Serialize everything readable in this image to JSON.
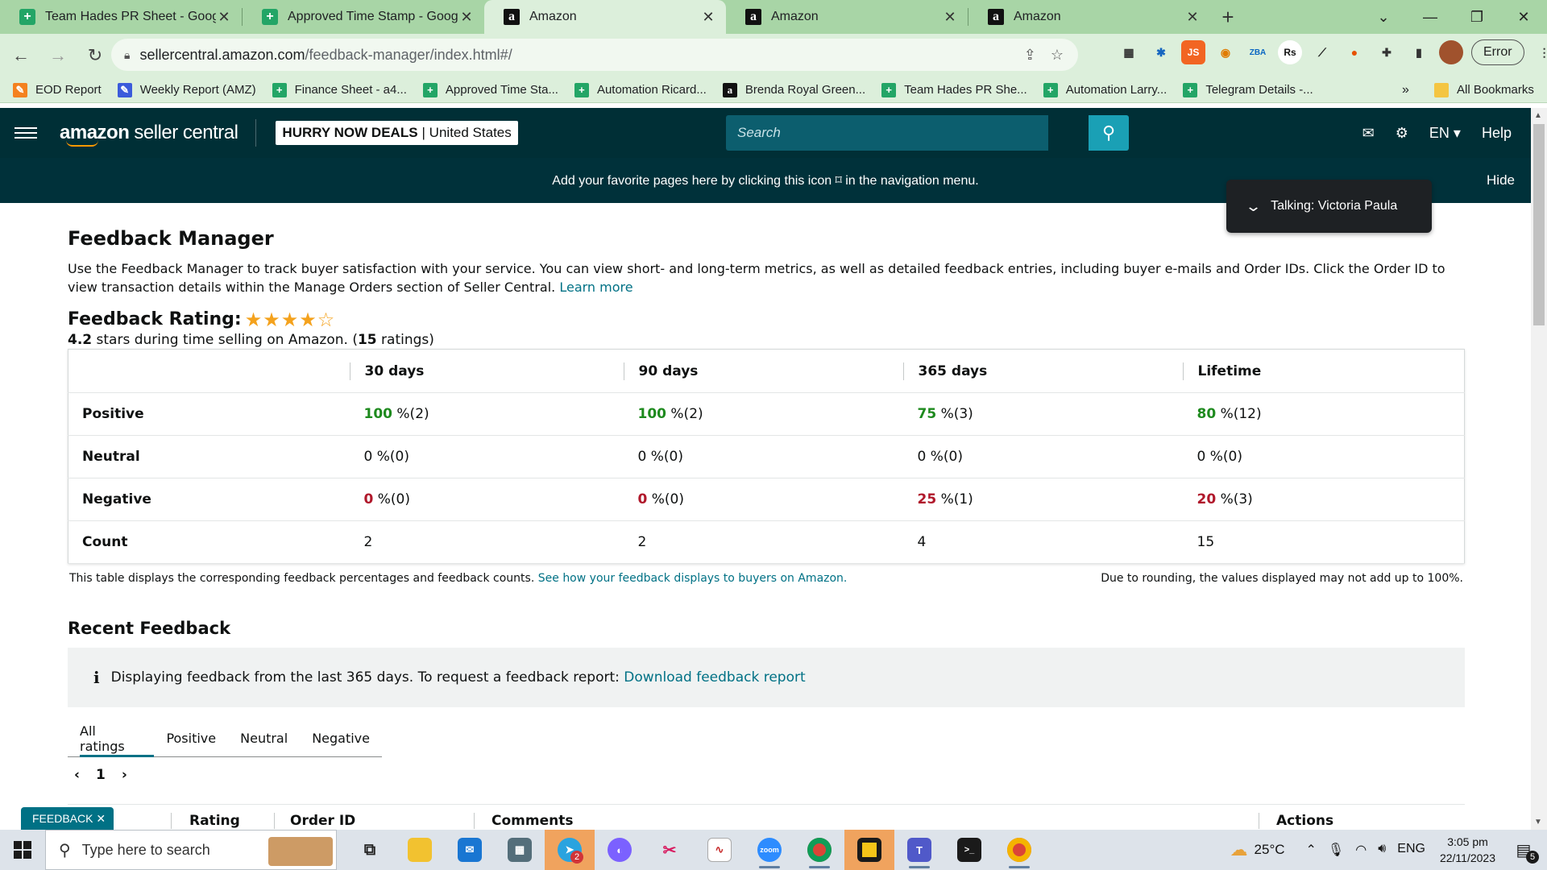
{
  "browser": {
    "tabs": [
      {
        "title": "Team Hades PR Sheet - Google S",
        "icon": "sheets",
        "active": false
      },
      {
        "title": "Approved Time Stamp - Google",
        "icon": "sheets",
        "active": false
      },
      {
        "title": "Amazon",
        "icon": "amazon",
        "active": true
      },
      {
        "title": "Amazon",
        "icon": "amazon",
        "active": false
      },
      {
        "title": "Amazon",
        "icon": "amazon",
        "active": false
      }
    ],
    "url_host": "sellercentral.amazon.com",
    "url_path": "/feedback-manager/index.html#/",
    "profile_status": "Error",
    "bookmarks": [
      {
        "label": "EOD Report",
        "icon": "orange"
      },
      {
        "label": "Weekly Report (AMZ)",
        "icon": "blue"
      },
      {
        "label": "Finance Sheet - a4...",
        "icon": "sheets"
      },
      {
        "label": "Approved Time Sta...",
        "icon": "sheets"
      },
      {
        "label": "Automation Ricard...",
        "icon": "sheets"
      },
      {
        "label": "Brenda Royal Green...",
        "icon": "amazon"
      },
      {
        "label": "Team Hades PR She...",
        "icon": "sheets"
      },
      {
        "label": "Automation Larry...",
        "icon": "sheets"
      },
      {
        "label": "Telegram Details -...",
        "icon": "sheets"
      }
    ],
    "bookmarks_more": "»",
    "all_bookmarks": "All Bookmarks"
  },
  "header": {
    "logo_bold": "amazon",
    "logo_rest": "seller central",
    "store_name": "HURRY NOW DEALS",
    "store_region": "| United States",
    "search_placeholder": "Search",
    "language": "EN",
    "help": "Help"
  },
  "banner": {
    "text": "Add your favorite pages here by clicking this icon ⌑ in the navigation menu.",
    "hide": "Hide"
  },
  "talking_popup": "Talking: Victoria Paula",
  "page": {
    "title": "Feedback Manager",
    "intro": "Use the Feedback Manager to track buyer satisfaction with your service. You can view short- and long-term metrics, as well as detailed feedback entries, including buyer e-mails and Order IDs. Click the Order ID to view transaction details within the Manage Orders section of Seller Central.",
    "learn_more": "Learn more",
    "rating_label": "Feedback Rating:",
    "rating_stars": 4,
    "rating_value": "4.2",
    "rating_mid": "stars during time selling on Amazon. (",
    "rating_count": "15",
    "rating_end": "ratings)",
    "table": {
      "headers": [
        "30 days",
        "90 days",
        "365 days",
        "Lifetime"
      ],
      "rows": [
        {
          "label": "Positive",
          "kind": "pos",
          "cells": [
            {
              "pct": "100",
              "cnt": "%(2)"
            },
            {
              "pct": "100",
              "cnt": "%(2)"
            },
            {
              "pct": "75",
              "cnt": "%(3)"
            },
            {
              "pct": "80",
              "cnt": "%(12)"
            }
          ]
        },
        {
          "label": "Neutral",
          "kind": "neu",
          "cells": [
            {
              "pct": "0",
              "cnt": "%(0)"
            },
            {
              "pct": "0",
              "cnt": "%(0)"
            },
            {
              "pct": "0",
              "cnt": "%(0)"
            },
            {
              "pct": "0",
              "cnt": "%(0)"
            }
          ]
        },
        {
          "label": "Negative",
          "kind": "neg",
          "cells": [
            {
              "pct": "0",
              "cnt": "%(0)"
            },
            {
              "pct": "0",
              "cnt": "%(0)"
            },
            {
              "pct": "25",
              "cnt": "%(1)"
            },
            {
              "pct": "20",
              "cnt": "%(3)"
            }
          ]
        },
        {
          "label": "Count",
          "kind": "count",
          "cells": [
            {
              "pct": "2",
              "cnt": ""
            },
            {
              "pct": "2",
              "cnt": ""
            },
            {
              "pct": "4",
              "cnt": ""
            },
            {
              "pct": "15",
              "cnt": ""
            }
          ]
        }
      ]
    },
    "table_note": "This table displays the corresponding feedback percentages and feedback counts.",
    "table_note_link": "See how your feedback displays to buyers on Amazon.",
    "rounding_note": "Due to rounding, the values displayed may not add up to 100%.",
    "recent_title": "Recent Feedback",
    "info_text": "Displaying feedback from the last 365 days. To request a feedback report:",
    "info_link": "Download feedback report",
    "rating_tabs": [
      "All ratings",
      "Positive",
      "Neutral",
      "Negative"
    ],
    "page_number": "1",
    "columns": [
      "Rating",
      "Order ID",
      "Comments",
      "Actions"
    ],
    "feedback_tag": "FEEDBACK"
  },
  "taskbar": {
    "search_placeholder": "Type here to search",
    "temperature": "25°C",
    "language": "ENG",
    "time": "3:05 pm",
    "date": "22/11/2023",
    "notification_count": "5",
    "telegram_badge": "2"
  }
}
